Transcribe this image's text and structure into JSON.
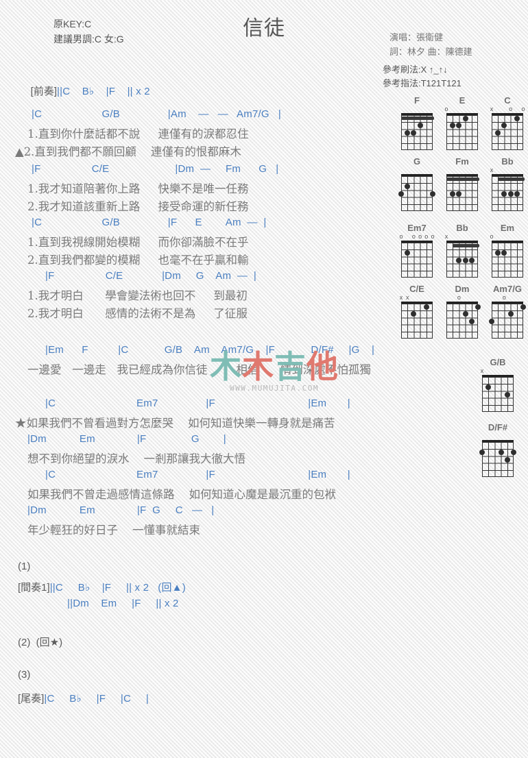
{
  "header": {
    "title": "信徒",
    "orig_key": "原KEY:C",
    "suggested_key": "建議男調:C 女:G",
    "singer": "演唱：張衛健",
    "writers": "詞：林夕   曲：陳德建",
    "strum_ref": "參考刷法:X ↑_↑↓",
    "finger_ref": "參考指法:T121T121"
  },
  "intro": {
    "label": "[前奏]",
    "chords": "||C    B♭    |F    || x 2"
  },
  "chord_diagrams": [
    {
      "name": "F",
      "marks": [],
      "barre": {
        "fret": 1,
        "from": 1,
        "to": 6
      },
      "dots": [
        {
          "s": 3,
          "f": 2
        },
        {
          "s": 4,
          "f": 3
        },
        {
          "s": 5,
          "f": 3
        }
      ]
    },
    {
      "name": "E",
      "marks": [
        {
          "sym": "o",
          "s": 6
        }
      ],
      "barre": null,
      "dots": [
        {
          "s": 3,
          "f": 1
        },
        {
          "s": 4,
          "f": 2
        },
        {
          "s": 5,
          "f": 2
        }
      ]
    },
    {
      "name": "C",
      "marks": [
        {
          "sym": "x",
          "s": 6
        },
        {
          "sym": "o",
          "s": 3
        },
        {
          "sym": "o",
          "s": 1
        }
      ],
      "barre": null,
      "dots": [
        {
          "s": 5,
          "f": 3
        },
        {
          "s": 4,
          "f": 2
        },
        {
          "s": 2,
          "f": 1
        }
      ]
    },
    {
      "name": "G",
      "marks": [],
      "barre": null,
      "dots": [
        {
          "s": 6,
          "f": 3
        },
        {
          "s": 5,
          "f": 2
        },
        {
          "s": 1,
          "f": 3
        }
      ]
    },
    {
      "name": "Fm",
      "marks": [],
      "barre": {
        "fret": 1,
        "from": 1,
        "to": 6
      },
      "dots": [
        {
          "s": 4,
          "f": 3
        },
        {
          "s": 5,
          "f": 3
        }
      ]
    },
    {
      "name": "Bb",
      "marks": [
        {
          "sym": "x",
          "s": 6
        }
      ],
      "barre": {
        "fret": 1,
        "from": 1,
        "to": 5
      },
      "dots": [
        {
          "s": 2,
          "f": 3
        },
        {
          "s": 3,
          "f": 3
        },
        {
          "s": 4,
          "f": 3
        }
      ]
    },
    {
      "name": "Em7",
      "marks": [
        {
          "sym": "o",
          "s": 6
        },
        {
          "sym": "o",
          "s": 4
        },
        {
          "sym": "o",
          "s": 3
        },
        {
          "sym": "o",
          "s": 2
        },
        {
          "sym": "o",
          "s": 1
        }
      ],
      "barre": null,
      "dots": [
        {
          "s": 5,
          "f": 2
        }
      ]
    },
    {
      "name": "Bb",
      "marks": [
        {
          "sym": "x",
          "s": 6
        }
      ],
      "barre": {
        "fret": 1,
        "from": 1,
        "to": 5
      },
      "dots": [
        {
          "s": 2,
          "f": 3
        },
        {
          "s": 3,
          "f": 3
        },
        {
          "s": 4,
          "f": 3
        }
      ]
    },
    {
      "name": "Em",
      "marks": [
        {
          "sym": "o",
          "s": 6
        }
      ],
      "barre": null,
      "dots": [
        {
          "s": 4,
          "f": 2
        },
        {
          "s": 5,
          "f": 2
        }
      ]
    },
    {
      "name": "C/E",
      "marks": [
        {
          "sym": "x",
          "s": 6
        },
        {
          "sym": "x",
          "s": 5
        }
      ],
      "barre": null,
      "dots": [
        {
          "s": 4,
          "f": 2
        },
        {
          "s": 2,
          "f": 1
        }
      ]
    },
    {
      "name": "Dm",
      "marks": [
        {
          "sym": "o",
          "s": 4
        }
      ],
      "barre": null,
      "dots": [
        {
          "s": 1,
          "f": 1
        },
        {
          "s": 2,
          "f": 3
        },
        {
          "s": 3,
          "f": 2
        }
      ]
    },
    {
      "name": "Am7/G",
      "marks": [
        {
          "sym": "o",
          "s": 4
        }
      ],
      "barre": null,
      "dots": [
        {
          "s": 1,
          "f": 1
        },
        {
          "s": 3,
          "f": 2
        },
        {
          "s": 6,
          "f": 3
        }
      ]
    },
    {
      "name": "G/B",
      "marks": [
        {
          "sym": "x",
          "s": 6
        }
      ],
      "barre": null,
      "dots": [
        {
          "s": 5,
          "f": 2
        },
        {
          "s": 2,
          "f": 3
        }
      ]
    },
    {
      "name": "D/F#",
      "marks": [],
      "barre": null,
      "dots": [
        {
          "s": 6,
          "f": 2
        },
        {
          "s": 3,
          "f": 2
        },
        {
          "s": 1,
          "f": 2
        },
        {
          "s": 2,
          "f": 3
        }
      ]
    }
  ],
  "verse1": {
    "chords_a": "|C                    G/B                |Am    —   —   Am7/G   |",
    "lyric_a1": "1.直到你什麼話都不說     連僅有的淚都忍住",
    "lyric_a2": "▲2.直到我們都不願回顧    連僅有的恨都麻木",
    "chords_b": "|F                 C/E                      |Dm  —     Fm      G   |",
    "lyric_b1": "1.我才知道陪著你上路     快樂不是唯一任務",
    "lyric_b2": "2.我才知道該重新上路     接受命運的新任務"
  },
  "verse2": {
    "chords_a": "|C                    G/B                |F      E        Am  —  |",
    "lyric_a1": "1.直到我視線開始模糊     而你卻滿臉不在乎",
    "lyric_a2": "2.直到我們都變的模糊     也毫不在乎贏和輸",
    "chords_b": "|F                 C/E             |Dm     G    Am  —  |",
    "lyric_b1": "1.我才明白      學會變法術也回不     到最初",
    "lyric_b2": "2.我才明白      感情的法術不是為     了征服"
  },
  "bridge": {
    "chords": "|Em      F          |C            G/B    Am    Am7/G    |F            D/F#     |G    |",
    "lyric": "一邊愛   一邊走   我已經成為你信徒        相信      情到深處不怕孤獨"
  },
  "chorus1": {
    "chords_a": "|C                           Em7                |F                               |Em       |",
    "lyric_a": "★如果我們不曾看過對方怎麼哭    如何知道快樂一轉身就是痛苦",
    "chords_b": "|Dm           Em              |F               G        |",
    "lyric_b": "想不到你絕望的淚水    一剎那讓我大徹大悟"
  },
  "chorus2": {
    "chords_a": "|C                           Em7                |F                               |Em       |",
    "lyric_a": "如果我們不曾走過感情這條路    如何知道心魔是最沉重的包袱",
    "chords_b": "|Dm           Em              |F  G     C   —   |",
    "lyric_b": "年少輕狂的好日子    一懂事就結束"
  },
  "sections": {
    "num1": "(1)",
    "interlude_label": "[間奏1]",
    "interlude_line1": "||C     B♭    |F     || x 2   (回▲)",
    "interlude_line2": "||Dm    Em     |F     || x 2",
    "num2": "(2)  (回★)",
    "num3": "(3)",
    "outro_label": "[尾奏]",
    "outro_chords": "|C     B♭     |F     |C     |"
  },
  "watermark": {
    "char1": "木",
    "char2": "木",
    "char3": "吉",
    "char4": "他",
    "url": "WWW.MUMUJITA.COM",
    "color_teal": "#7fbdb5",
    "color_red": "#e0796f"
  },
  "colors": {
    "chord_blue": "#4a7fc1",
    "bar_gold": "#b5812b",
    "bar_red": "#b5442b",
    "lyric_gray": "#7a7a7a",
    "page_bg": "#f3f3f3"
  }
}
